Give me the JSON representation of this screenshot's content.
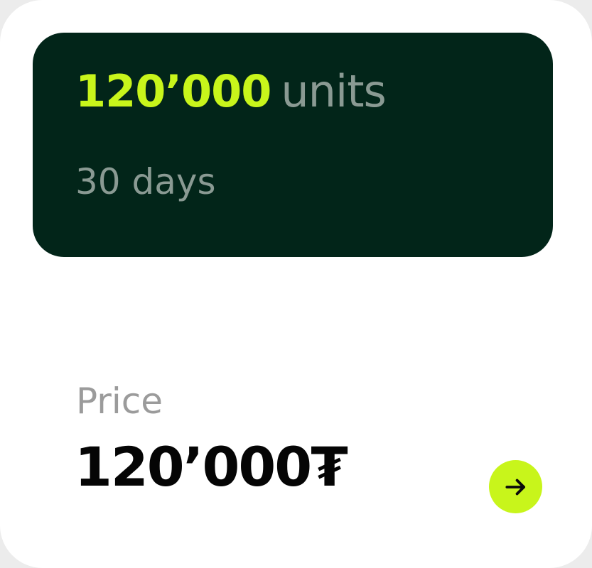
{
  "plan": {
    "amount": "120’000",
    "unit": "units",
    "duration": "30 days"
  },
  "price": {
    "label": "Price",
    "value": "120’000₮"
  },
  "action": {
    "icon": "arrow-right-icon"
  },
  "colors": {
    "card_background": "#ffffff",
    "plan_background": "#022519",
    "accent": "#c8f51b",
    "muted_text": "#8a9a93",
    "label_text": "#9b9b9b",
    "price_text": "#050505"
  }
}
